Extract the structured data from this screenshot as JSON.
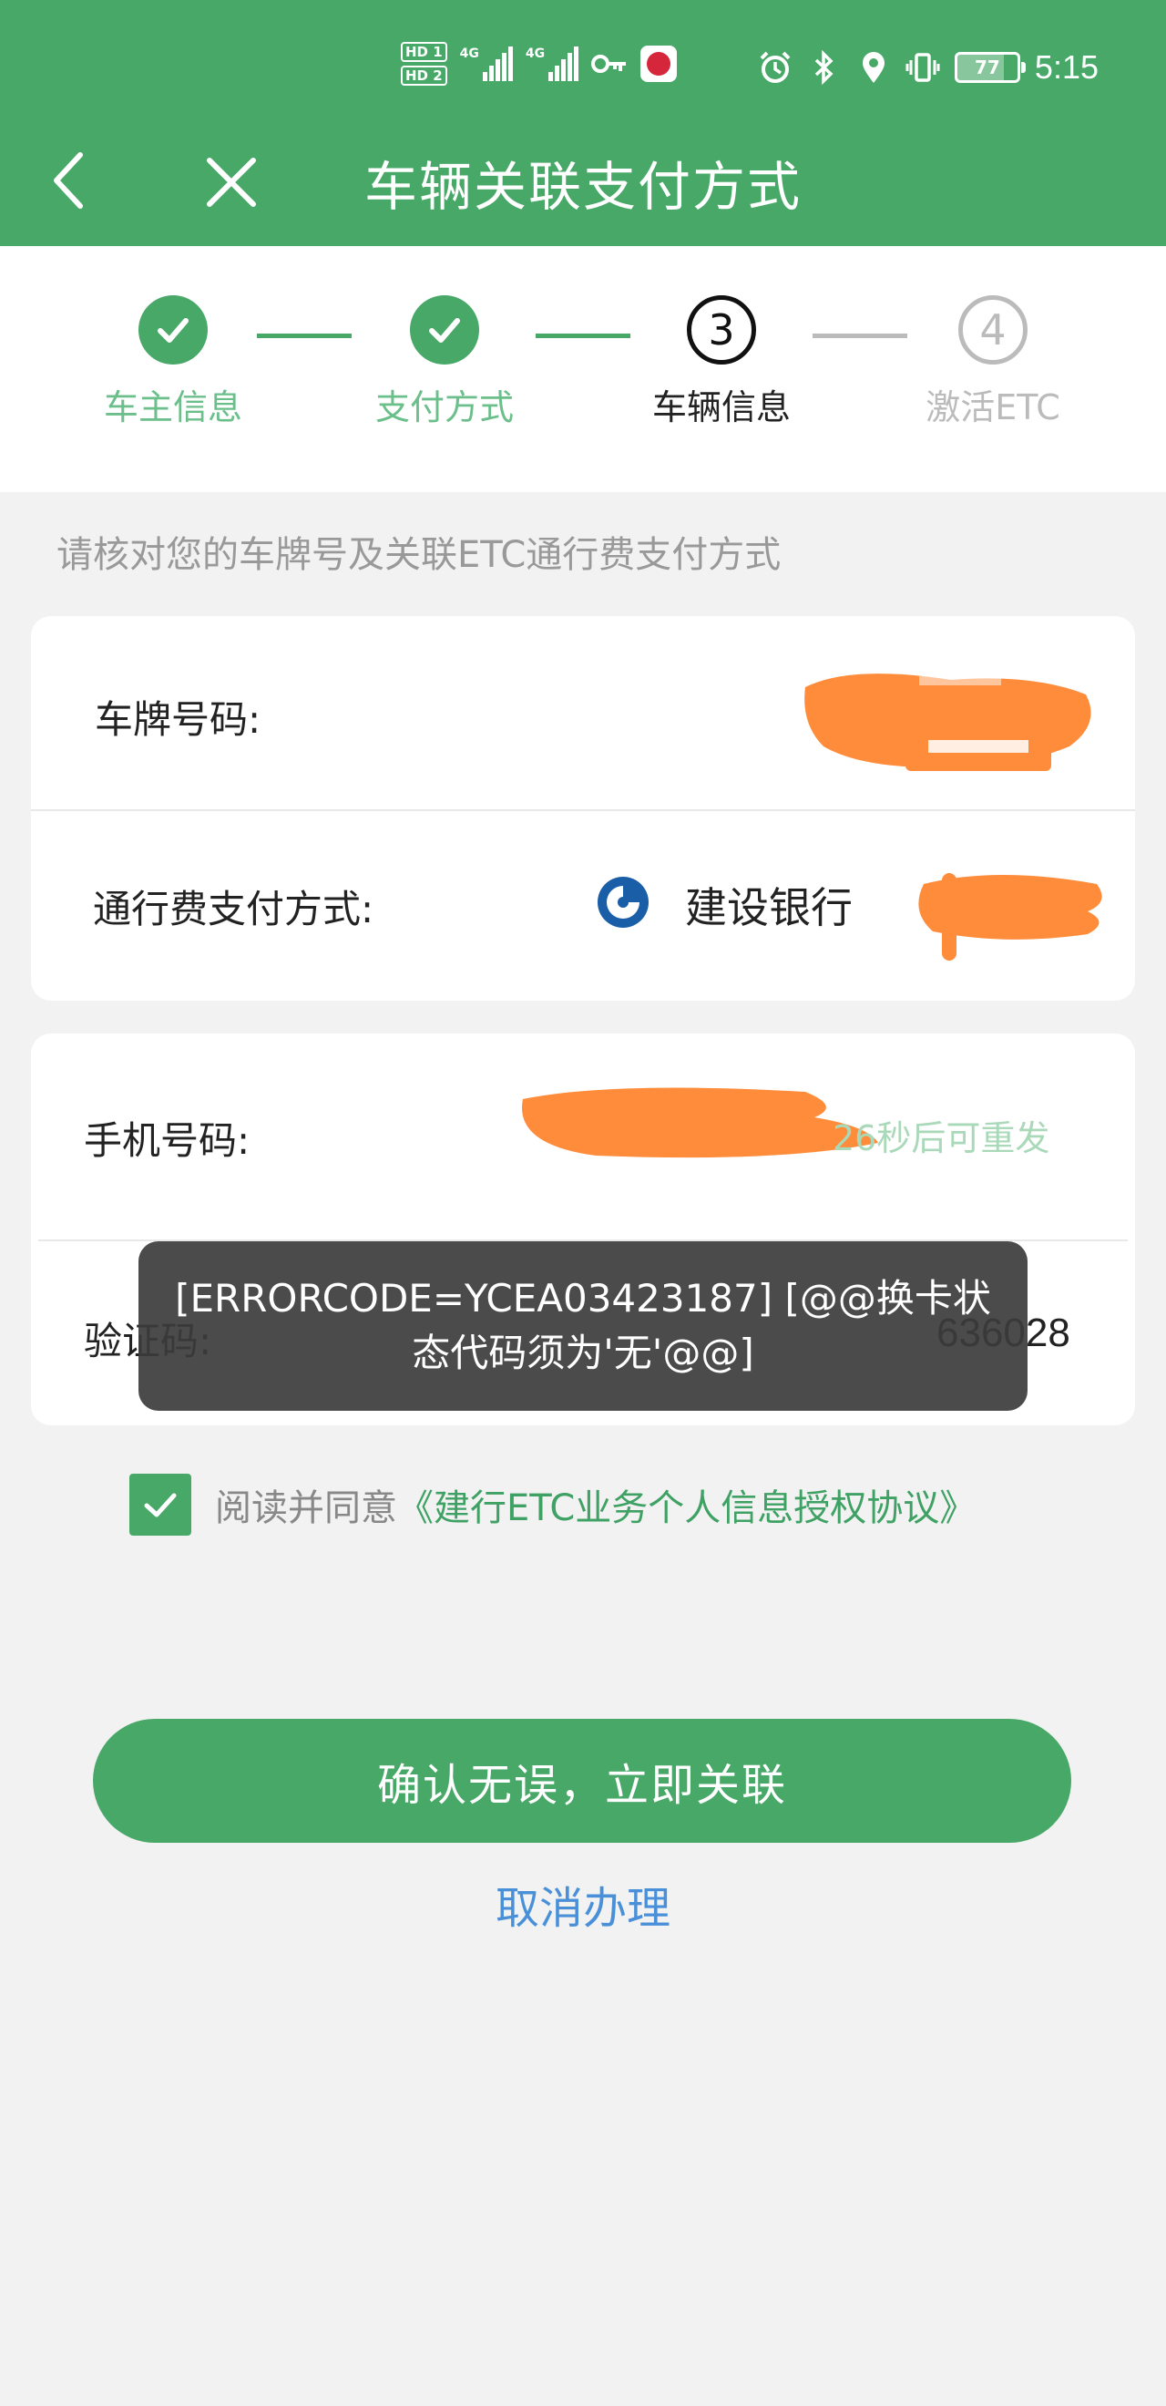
{
  "status_bar": {
    "hd1": "HD 1",
    "hd2": "HD 2",
    "net1": "4G",
    "net2": "4G",
    "battery": "77",
    "time": "5:15"
  },
  "header": {
    "title": "车辆关联支付方式"
  },
  "stepper": {
    "steps": [
      {
        "label": "车主信息",
        "state": "done"
      },
      {
        "label": "支付方式",
        "state": "done"
      },
      {
        "label": "车辆信息",
        "state": "current",
        "number": "3"
      },
      {
        "label": "激活ETC",
        "state": "todo",
        "number": "4"
      }
    ]
  },
  "hint": "请核对您的车牌号及关联ETC通行费支付方式",
  "vehicle": {
    "plate_label": "车牌号码:",
    "payment_label": "通行费支付方式:",
    "bank_name": "建设银行"
  },
  "verify": {
    "phone_label": "手机号码:",
    "resend_text": "26秒后可重发",
    "code_label": "验证码:",
    "code_value": "636028"
  },
  "toast": {
    "message": "[ERRORCODE=YCEA03423187] [@@换卡状态代码须为'无'@@]"
  },
  "agreement": {
    "checked": true,
    "prefix": "阅读并同意",
    "link": "《建行ETC业务个人信息授权协议》"
  },
  "actions": {
    "confirm": "确认无误，立即关联",
    "cancel": "取消办理"
  },
  "colors": {
    "primary": "#48a868",
    "link_blue": "#4a90d9",
    "redaction": "#ff8c3a",
    "toast_bg": "#3c3c3c"
  }
}
